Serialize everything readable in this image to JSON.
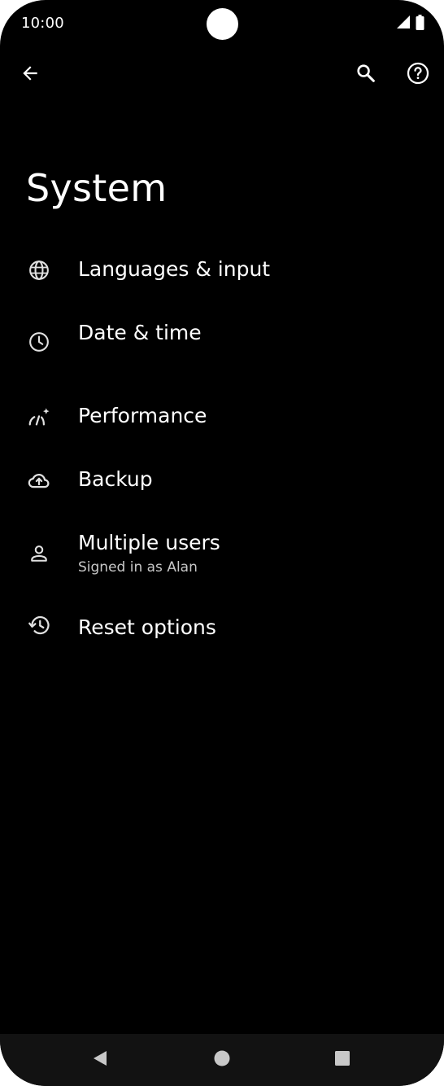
{
  "status_bar": {
    "time": "10:00",
    "signal_icon": "cell-signal-icon",
    "battery_icon": "battery-icon"
  },
  "top_bar": {
    "back_icon": "arrow-back-icon",
    "search_icon": "search-icon",
    "help_icon": "help-icon"
  },
  "page": {
    "title": "System"
  },
  "settings": {
    "items": [
      {
        "label": "Languages & input",
        "icon": "globe-icon"
      },
      {
        "label": "Date & time",
        "icon": "clock-icon"
      },
      {
        "label": "Performance",
        "icon": "performance-icon"
      },
      {
        "label": "Backup",
        "icon": "cloud-upload-icon"
      },
      {
        "label": "Multiple users",
        "summary": "Signed in as Alan",
        "icon": "person-icon"
      },
      {
        "label": "Reset options",
        "icon": "history-icon"
      }
    ]
  },
  "nav_bar": {
    "back_icon": "nav-back-icon",
    "home_icon": "nav-home-icon",
    "recents_icon": "nav-recents-icon"
  },
  "colors": {
    "background": "#000000",
    "text_primary": "#ffffff",
    "text_secondary": "#c8c8c8",
    "nav_bar": "#121212",
    "icon": "#e0e0e0"
  }
}
